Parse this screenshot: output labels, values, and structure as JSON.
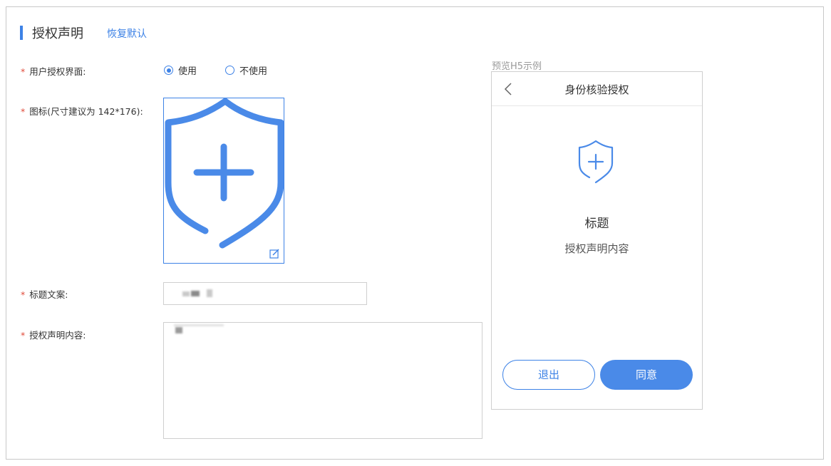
{
  "section": {
    "title": "授权声明",
    "restore_label": "恢复默认"
  },
  "form": {
    "auth_ui": {
      "required_mark": "*",
      "label": "用户授权界面:",
      "options": [
        {
          "label": "使用",
          "checked": true
        },
        {
          "label": "不使用",
          "checked": false
        }
      ]
    },
    "icon": {
      "required_mark": "*",
      "label": "图标(尺寸建议为 142*176):",
      "icon_name": "shield-plus-icon"
    },
    "title_copy": {
      "required_mark": "*",
      "label": "标题文案:"
    },
    "auth_content": {
      "required_mark": "*",
      "label": "授权声明内容:"
    }
  },
  "preview": {
    "caption": "预览H5示例",
    "header_title": "身份核验授权",
    "heading": "标题",
    "content": "授权声明内容",
    "exit_label": "退出",
    "agree_label": "同意"
  },
  "colors": {
    "accent": "#3d82e6",
    "required": "#e04b3a",
    "border": "#cfcfcf"
  }
}
